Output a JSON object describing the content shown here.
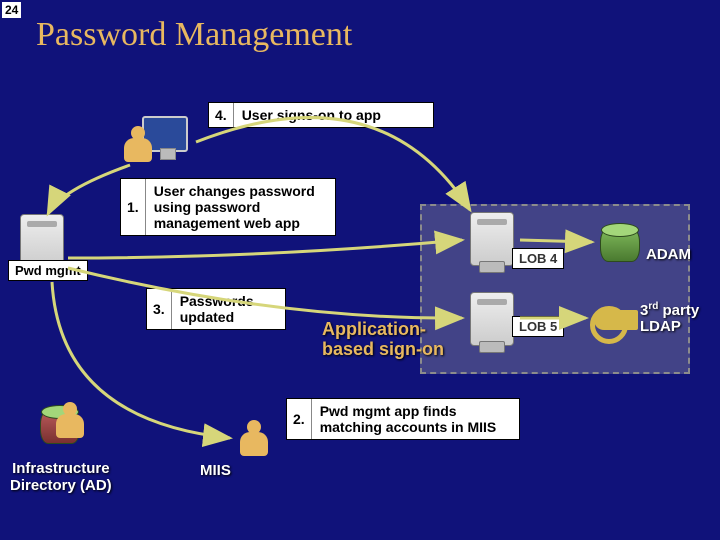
{
  "page_number": "24",
  "title": "Password Management",
  "steps": {
    "s1": {
      "num": "1.",
      "text": "User changes password using password management web app"
    },
    "s2": {
      "num": "2.",
      "text": "Pwd mgmt app finds matching accounts in MIIS"
    },
    "s3": {
      "num": "3.",
      "text": "Passwords updated"
    },
    "s4": {
      "num": "4.",
      "text": "User signs-on to app"
    }
  },
  "labels": {
    "pwd_mgmt": "Pwd mgmt",
    "lob4": "LOB 4",
    "lob5": "LOB 5",
    "adam": "ADAM",
    "third_party_part1": "3",
    "third_party_sup": "rd",
    "third_party_part2": " party",
    "third_party_line2": "LDAP",
    "miis": "MIIS",
    "infra_line1": "Infrastructure",
    "infra_line2": "Directory (AD)",
    "app_signon_line1": "Application-",
    "app_signon_line2": "based sign-on"
  }
}
